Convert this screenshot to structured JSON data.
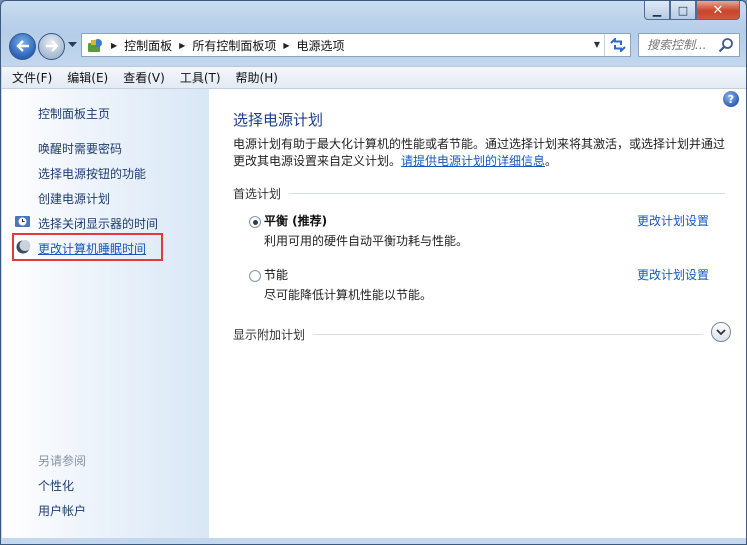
{
  "window": {
    "minimize_symbol": "▁",
    "maximize_symbol": "□",
    "close_symbol": "✕"
  },
  "nav": {
    "breadcrumbs": [
      "控制面板",
      "所有控制面板项",
      "电源选项"
    ],
    "search_placeholder": "搜索控制..."
  },
  "menu": {
    "items": [
      "文件(F)",
      "编辑(E)",
      "查看(V)",
      "工具(T)",
      "帮助(H)"
    ]
  },
  "sidebar": {
    "home": "控制面板主页",
    "links": [
      "唤醒时需要密码",
      "选择电源按钮的功能",
      "创建电源计划",
      "选择关闭显示器的时间",
      "更改计算机睡眠时间"
    ],
    "see_also_title": "另请参阅",
    "see_also": [
      "个性化",
      "用户帐户"
    ]
  },
  "main": {
    "title": "选择电源计划",
    "description_prefix": "电源计划有助于最大化计算机的性能或者节能。通过选择计划来将其激活，或选择计划并通过更改其电源设置来自定义计划。",
    "description_link": "请提供电源计划的详细信息",
    "description_suffix": "。",
    "preferred_label": "首选计划",
    "plans": [
      {
        "name": "平衡 (推荐)",
        "description": "利用可用的硬件自动平衡功耗与性能。",
        "settings_link": "更改计划设置",
        "selected": true
      },
      {
        "name": "节能",
        "description": "尽可能降低计算机性能以节能。",
        "settings_link": "更改计划设置",
        "selected": false
      }
    ],
    "show_more_label": "显示附加计划",
    "help_symbol": "?"
  },
  "colors": {
    "link": "#1558c0",
    "title": "#1e3e8b",
    "highlight": "#e53935"
  }
}
